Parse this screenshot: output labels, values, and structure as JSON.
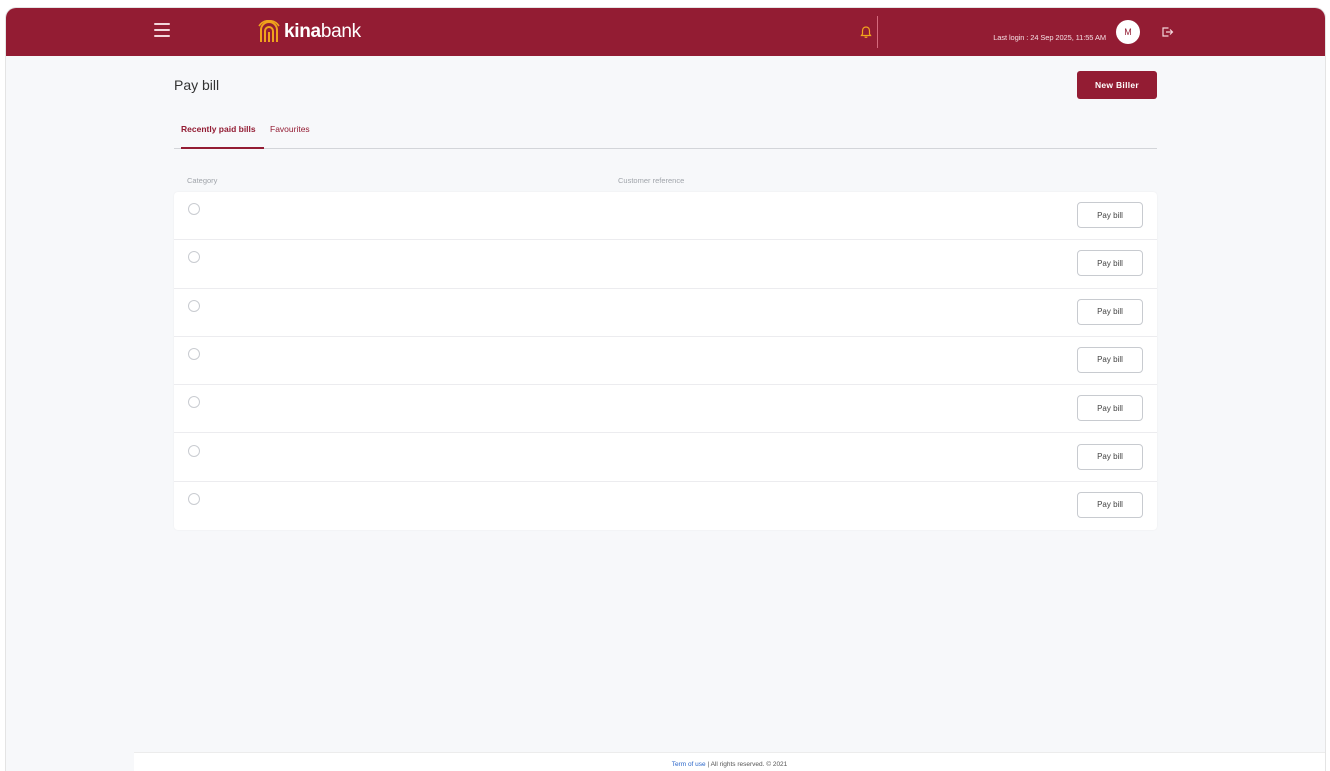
{
  "header": {
    "brand_bold": "kina",
    "brand_rest": "bank",
    "last_login": "Last login : 24 Sep 2025, 11:55 AM",
    "avatar_initial": "M",
    "icons": [
      "menu-icon",
      "bell-icon",
      "logout-icon"
    ]
  },
  "page": {
    "title": "Pay bill",
    "new_biller_label": "New Biller"
  },
  "tabs": [
    {
      "label": "Recently paid bills",
      "active": true
    },
    {
      "label": "Favourites",
      "active": false
    }
  ],
  "table": {
    "columns": [
      "Category",
      "Customer reference"
    ],
    "rows": [
      {
        "action": "Pay bill"
      },
      {
        "action": "Pay bill"
      },
      {
        "action": "Pay bill"
      },
      {
        "action": "Pay bill"
      },
      {
        "action": "Pay bill"
      },
      {
        "action": "Pay bill"
      },
      {
        "action": "Pay bill"
      }
    ]
  },
  "footer": {
    "link": "Term of use",
    "text": " | All rights reserved. © 2021"
  },
  "colors": {
    "brand": "#931c33",
    "logo_mark": "#f0a21c",
    "bell": "#f3a51d",
    "link": "#2a66c9"
  }
}
